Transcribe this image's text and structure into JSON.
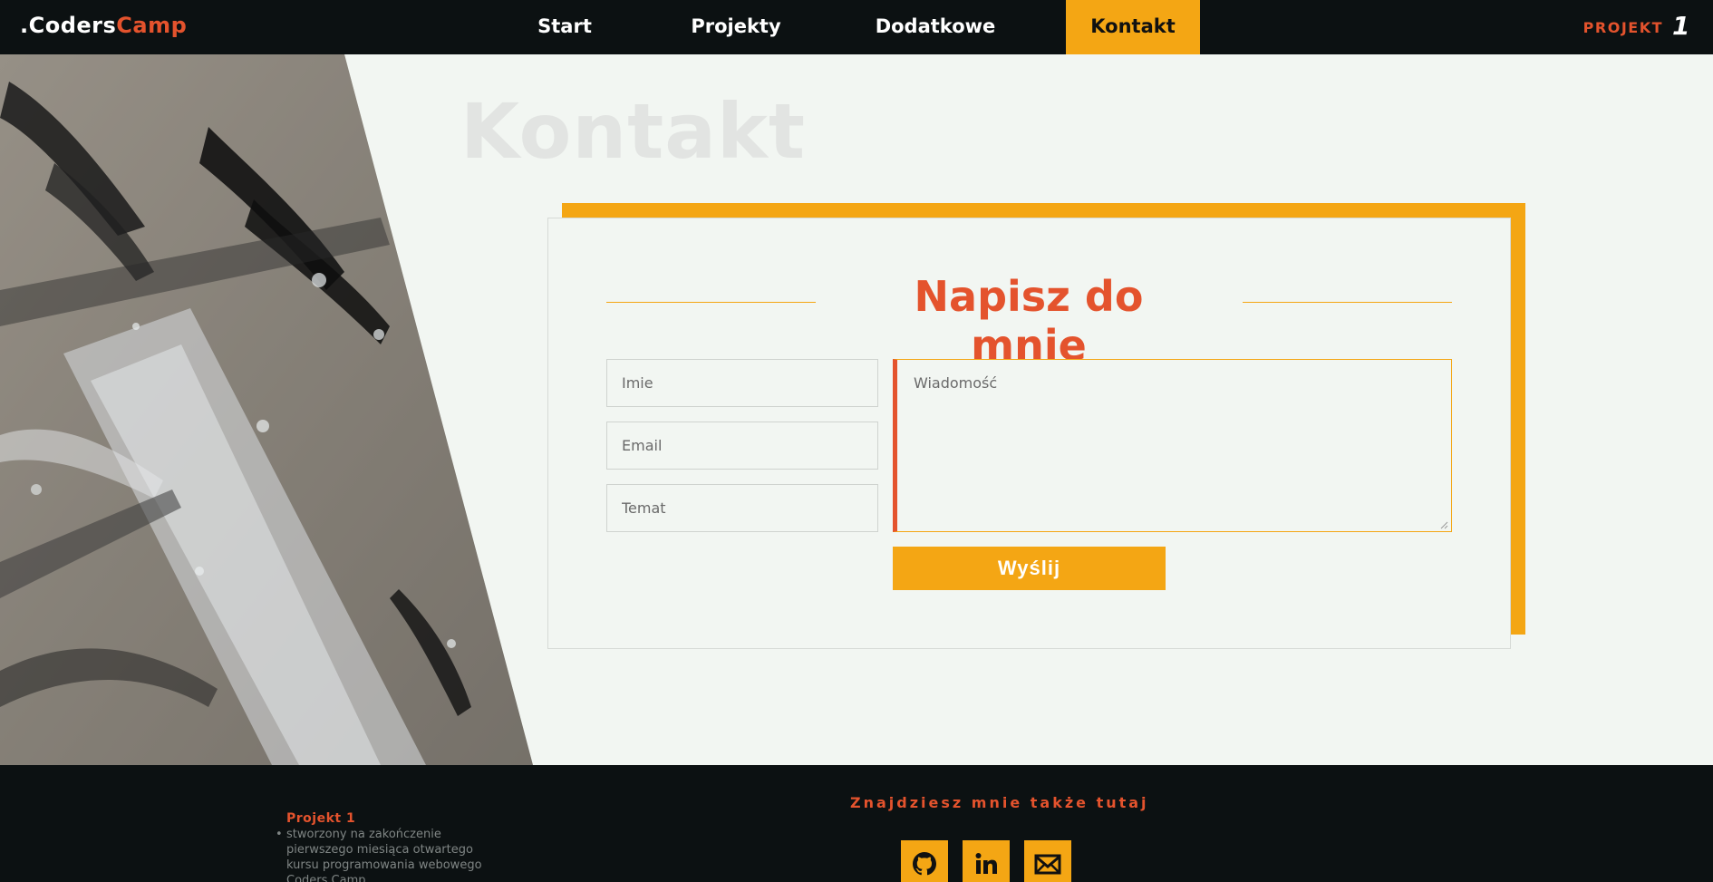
{
  "brand": {
    "prefix": ".Coders",
    "accent": "Camp"
  },
  "nav": {
    "start": "Start",
    "projekty": "Projekty",
    "dodatkowe": "Dodatkowe",
    "kontakt": "Kontakt"
  },
  "project_tag": {
    "label": "PROJEKT",
    "number": "1"
  },
  "page_title": "Kontakt",
  "form": {
    "title": "Napisz do mnie",
    "imie_placeholder": "Imie",
    "email_placeholder": "Email",
    "temat_placeholder": "Temat",
    "message_placeholder": "Wiadomość",
    "send_label": "Wyślij"
  },
  "footer": {
    "project_title": "Projekt 1",
    "project_items": [
      "stworzony na zakończenie pierwszego miesiąca otwartego kursu programowania webowego Coders Camp"
    ],
    "social_title": "Znajdziesz mnie także tutaj",
    "social": [
      "github-icon",
      "linkedin-icon",
      "mail-icon"
    ]
  },
  "colors": {
    "accent_orange": "#f4a614",
    "accent_red": "#e4532d",
    "dark": "#0c1112",
    "background": "#f2f6f2"
  }
}
